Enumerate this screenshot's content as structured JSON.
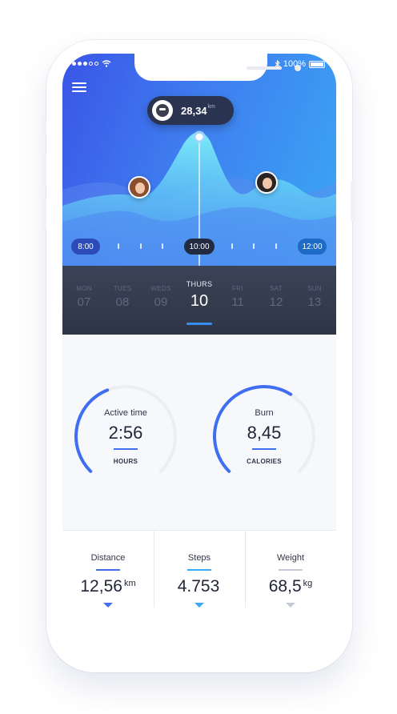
{
  "status_bar": {
    "battery": "100%"
  },
  "tooltip": {
    "value": "28,34",
    "unit": "km"
  },
  "timeline": {
    "start": "8:00",
    "current": "10:00",
    "end": "12:00"
  },
  "days": [
    {
      "name": "MON",
      "num": "07"
    },
    {
      "name": "TUES",
      "num": "08"
    },
    {
      "name": "WEDS",
      "num": "09"
    },
    {
      "name": "THURS",
      "num": "10",
      "active": true
    },
    {
      "name": "FRI",
      "num": "11"
    },
    {
      "name": "SAT",
      "num": "12"
    },
    {
      "name": "SUN",
      "num": "13"
    }
  ],
  "rings": [
    {
      "label": "Active time",
      "value": "2:56",
      "unit": "HOURS",
      "progress": 0.42
    },
    {
      "label": "Burn",
      "value": "8,45",
      "unit": "CALORIES",
      "progress": 0.62
    }
  ],
  "stats": [
    {
      "label": "Distance",
      "value": "12,56",
      "unit": "km",
      "accent": "#3f6ef0"
    },
    {
      "label": "Steps",
      "value": "4.753",
      "unit": "",
      "accent": "#39a8f5"
    },
    {
      "label": "Weight",
      "value": "68,5",
      "unit": "kg",
      "accent": "#c5cad8"
    }
  ],
  "colors": {
    "accent_blue": "#3f6ef0",
    "light_blue": "#39a8f5",
    "dark_panel": "#2e3546"
  },
  "icons": [
    "wifi-icon",
    "bluetooth-icon",
    "battery-icon",
    "menu-icon"
  ]
}
